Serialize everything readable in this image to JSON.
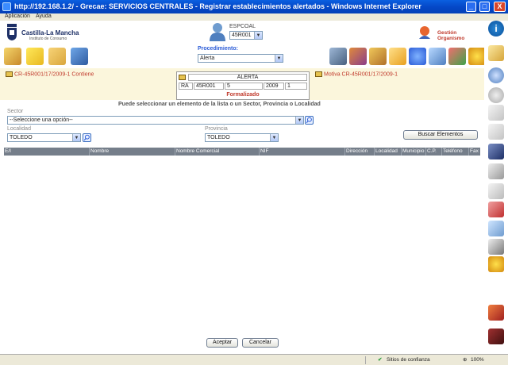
{
  "window": {
    "title": "http://192.168.1.2/ - Grecae: SERVICIOS CENTRALES - Registrar establecimientos alertados - Windows Internet Explorer",
    "buttons": [
      "_",
      "□",
      "X"
    ]
  },
  "menu": {
    "items": [
      "Aplicación",
      "Ayuda"
    ]
  },
  "header": {
    "logo_title": "Castilla-La Mancha",
    "logo_subtitle": "Instituto de Consumo",
    "user_code_label": "ESPCOAL",
    "user_code_value": "45R001",
    "gestion_label": "Gestión Organismo",
    "info_icon": "i"
  },
  "procedure": {
    "label": "Procedimiento:",
    "value": "Alerta"
  },
  "info_band": {
    "left_link": "CR-45R001/17/2009-1 Contiene",
    "right_link": "Motiva CR-45R001/17/2009-1",
    "alerta": {
      "title": "ALERTA",
      "cells": [
        "RA",
        "45R001",
        "5",
        "2009",
        "1"
      ],
      "status": "Formalizado"
    }
  },
  "form": {
    "instruction": "Puede seleccionar un elemento de la lista o un Sector, Provincia o Localidad",
    "sector_label": "Sector",
    "sector_value": "--Seleccione una opción--",
    "localidad_label": "Localidad",
    "localidad_value": "TOLEDO",
    "provincia_label": "Provincia",
    "provincia_value": "TOLEDO",
    "search_button": "Buscar Elementos"
  },
  "table": {
    "columns": [
      "E/I",
      "Nombre",
      "Nombre Comercial",
      "NIF",
      "Dirección",
      "Localidad",
      "Municipio",
      "C.P.",
      "Teléfono",
      "Fax"
    ]
  },
  "footer": {
    "accept_button": "Aceptar",
    "cancel_button": "Cancelar"
  },
  "statusbar": {
    "zone": "Sitios de confianza",
    "zoom": "100%"
  },
  "colors": {
    "title_bar": "#0548c8",
    "link_red": "#c0392b",
    "procedure_blue": "#2a5bd7",
    "table_header": "#757e8a",
    "info_band": "#fbf6dc"
  }
}
